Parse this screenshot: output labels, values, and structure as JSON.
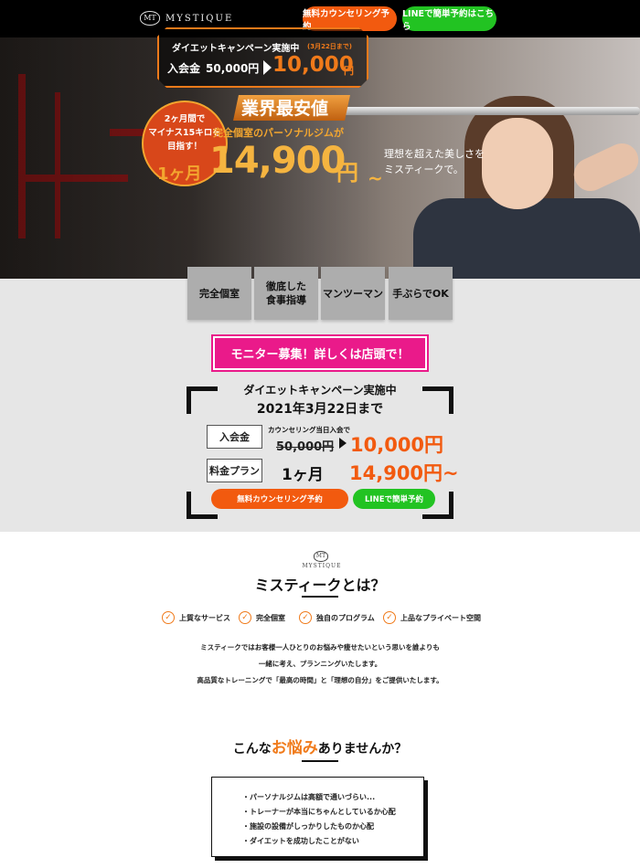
{
  "header": {
    "logo_mark": "MT",
    "logo_text": "MYSTIQUE",
    "counseling_button": "無料カウンセリング予約",
    "line_button": "LINEで簡単予約はこちら"
  },
  "hero": {
    "campaign_title": "ダイエットキャンペーン実施中",
    "campaign_date": "(3月22日まで)",
    "fee_label": "入会金",
    "fee_old": "50,000円",
    "fee_new": "10,000",
    "fee_new_unit": "円",
    "badge_line1": "2ヶ月間で",
    "badge_line2": "マイナス15キロを",
    "badge_line3": "目指す！",
    "lowest": "業界最安値",
    "private_gym": "完全個室のパーソナルジムが",
    "month": "1ヶ月",
    "price": "14,900",
    "price_unit": "円",
    "tilde": "~",
    "tagline_1": "理想を超えた美しさを",
    "tagline_2": "ミスティークで。"
  },
  "features": [
    "完全個室",
    "徹底した\n食事指導",
    "マンツーマン",
    "手ぶらでOK"
  ],
  "monitor_banner": "モニター募集！詳しくは店頭で！",
  "price_card": {
    "title": "ダイエットキャンペーン実施中",
    "date": "2021年3月22日まで",
    "fee_label": "入会金",
    "counseling_note": "カウンセリング当日入会で",
    "old_price": "50,000円",
    "new_price": "10,000円",
    "plan_label": "料金プラン",
    "plan_value": "1ヶ月",
    "plan_price": "14,900円~",
    "cta_counseling": "無料カウンセリング予約",
    "cta_line": "LINEで簡単予約"
  },
  "about": {
    "logo_mark": "MT",
    "logo_text": "MYSTIQUE",
    "title": "ミスティークとは？",
    "points": [
      "上質なサービス",
      "完全個室",
      "独自のプログラム",
      "上品なプライベート空間"
    ],
    "line1": "ミスティークではお客様一人ひとりのお悩みや痩せたいという思いを誰よりも",
    "line2": "一緒に考え、プランニングいたします。",
    "line3": "高品質なトレーニングで「最高の時間」と「理想の自分」をご提供いたします。"
  },
  "worries": {
    "title_pre": "こんな",
    "title_em": "お悩み",
    "title_post": "ありませんか？",
    "items": [
      "・パーソナルジムは高額で通いづらい...",
      "・トレーナーが本当にちゃんとしているか心配",
      "・施設の設備がしっかりしたものか心配",
      "・ダイエットを成功したことがない"
    ]
  },
  "colors": {
    "accent_orange": "#f25a0f",
    "line_green": "#22c322",
    "monitor_pink": "#ea1a8a"
  }
}
